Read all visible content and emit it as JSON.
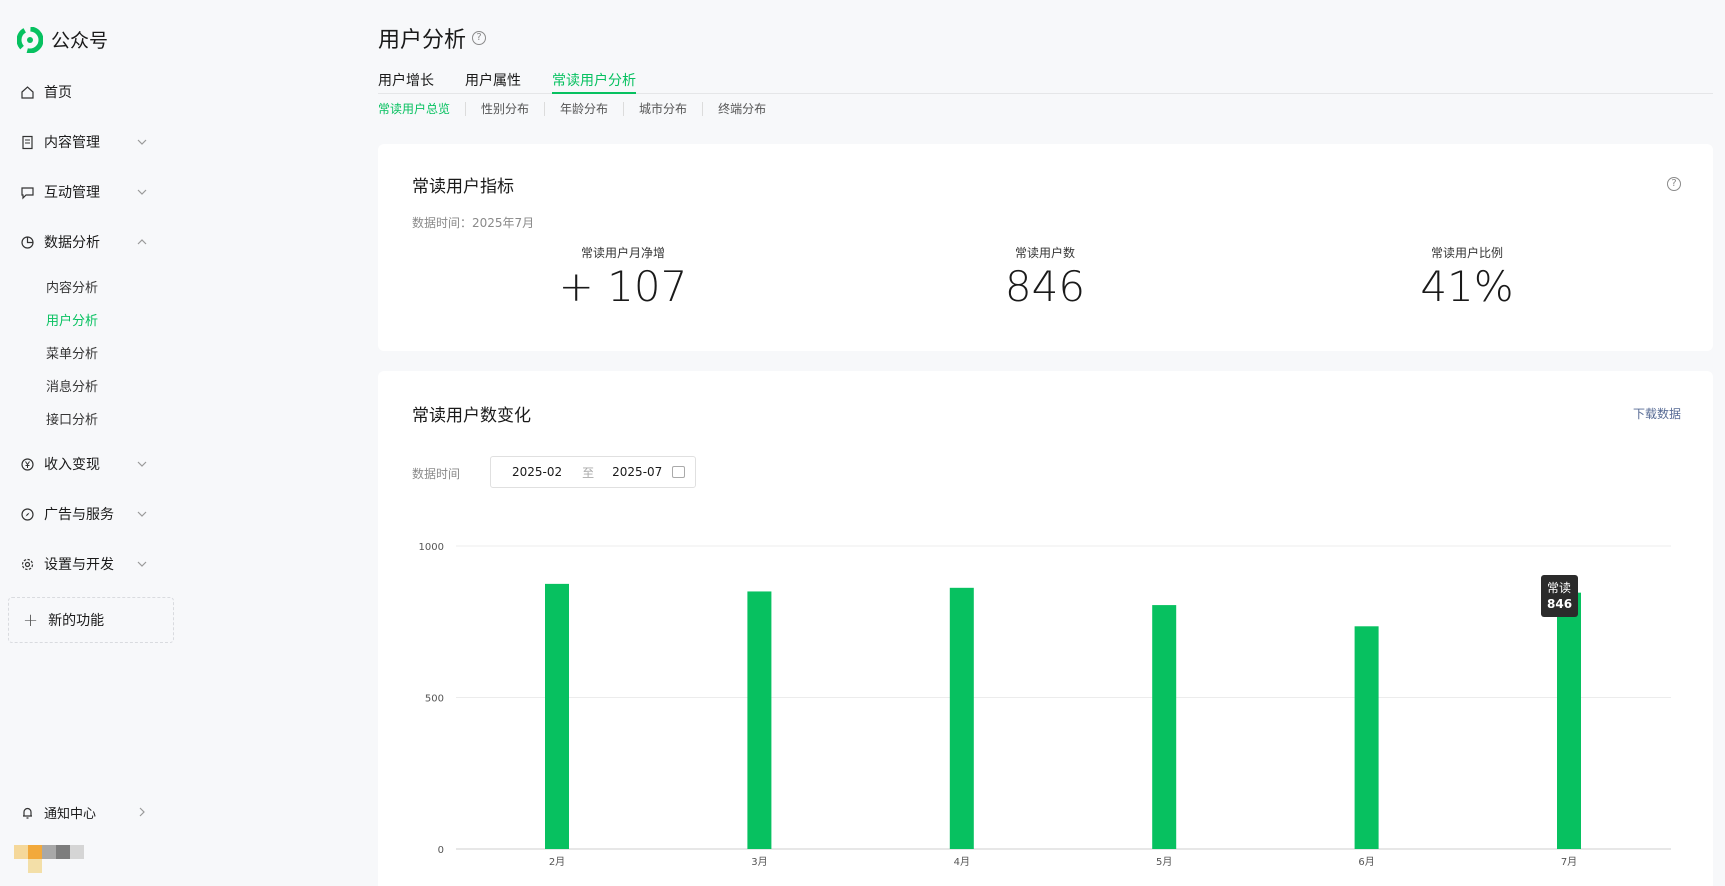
{
  "app": {
    "name": "公众号"
  },
  "sidebar": {
    "items": [
      {
        "label": "首页"
      },
      {
        "label": "内容管理"
      },
      {
        "label": "互动管理"
      },
      {
        "label": "数据分析"
      },
      {
        "label": "收入变现"
      },
      {
        "label": "广告与服务"
      },
      {
        "label": "设置与开发"
      }
    ],
    "data_sub": [
      {
        "label": "内容分析"
      },
      {
        "label": "用户分析"
      },
      {
        "label": "菜单分析"
      },
      {
        "label": "消息分析"
      },
      {
        "label": "接口分析"
      }
    ],
    "new_feature": "新的功能",
    "notify": "通知中心"
  },
  "header": {
    "title": "用户分析",
    "tabs": [
      {
        "label": "用户增长"
      },
      {
        "label": "用户属性"
      },
      {
        "label": "常读用户分析"
      }
    ],
    "subtabs": [
      {
        "label": "常读用户总览"
      },
      {
        "label": "性别分布"
      },
      {
        "label": "年龄分布"
      },
      {
        "label": "城市分布"
      },
      {
        "label": "终端分布"
      }
    ]
  },
  "metrics_card": {
    "title": "常读用户指标",
    "data_time": "数据时间：2025年7月",
    "metrics": [
      {
        "label": "常读用户月净增",
        "value": "+ 107"
      },
      {
        "label": "常读用户数",
        "value": "846"
      },
      {
        "label": "常读用户比例",
        "value": "41%"
      }
    ]
  },
  "trend_card": {
    "title": "常读用户数变化",
    "download": "下载数据",
    "date_label": "数据时间",
    "date_from": "2025-02",
    "date_sep": "至",
    "date_to": "2025-07",
    "tooltip": {
      "label": "常读",
      "value": "846"
    }
  },
  "colors": {
    "accent": "#07c160",
    "link": "#576b95"
  },
  "chart_data": {
    "type": "bar",
    "categories": [
      "2月",
      "3月",
      "4月",
      "5月",
      "6月",
      "7月"
    ],
    "series": [
      {
        "values": [
          875,
          850,
          862,
          805,
          735,
          846
        ]
      }
    ],
    "ylim": [
      0,
      1000
    ],
    "yticks": [
      "0",
      "500",
      "1000"
    ],
    "grid": true,
    "title": "",
    "xlabel": "",
    "ylabel": ""
  }
}
